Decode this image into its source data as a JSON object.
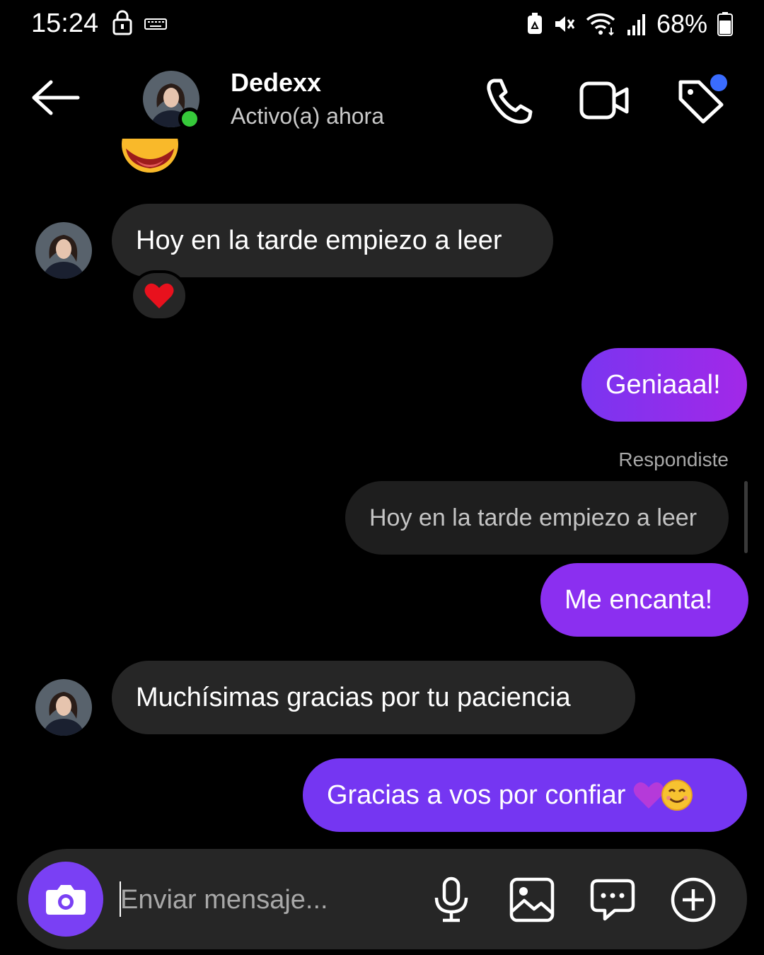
{
  "status_bar": {
    "time": "15:24",
    "battery": "68%",
    "icons": [
      "lock-icon",
      "keyboard-icon",
      "battery-saver-icon",
      "mute-icon",
      "wifi-icon",
      "signal-icon",
      "battery-icon"
    ]
  },
  "header": {
    "name": "Dedexx",
    "status": "Activo(a) ahora",
    "icons": [
      "back-arrow-icon",
      "phone-icon",
      "video-icon",
      "tag-icon"
    ]
  },
  "messages": [
    {
      "side": "in",
      "text": "Hoy en la tarde empiezo a leer",
      "reaction": "heart-emoji"
    },
    {
      "side": "out",
      "text": "Geniaaal!"
    },
    {
      "side": "out",
      "label": "Respondiste",
      "reply_quote": "Hoy en la tarde empiezo a leer",
      "text": "Me encanta!"
    },
    {
      "side": "in",
      "text": "Muchísimas gracias por tu paciencia"
    },
    {
      "side": "out",
      "text": "Gracias a vos por confiar"
    }
  ],
  "composer": {
    "placeholder": "Enviar mensaje...",
    "icons": [
      "camera-icon",
      "microphone-icon",
      "gallery-icon",
      "chat-sticker-icon",
      "add-icon"
    ]
  },
  "colors": {
    "background": "#000000",
    "incoming_bubble": "#262626",
    "outgoing_bubble": "#8b2ff0",
    "online": "#36c93a",
    "notification": "#3a6cff"
  }
}
